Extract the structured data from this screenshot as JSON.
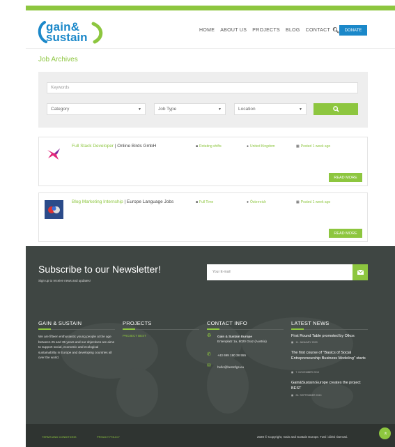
{
  "header": {
    "logo_line1": "gain&",
    "logo_line2": "sustain",
    "nav": [
      "HOME",
      "ABOUT US",
      "PROJECTS",
      "BLOG",
      "CONTACT"
    ],
    "donate_label": "DONATE"
  },
  "page_title": "Job Archives",
  "search": {
    "keywords_placeholder": "Keywords",
    "category": "Category",
    "job_type": "Job Type",
    "location": "Location"
  },
  "jobs": [
    {
      "title": "Full Stack Developer",
      "company": "Online Birds GmbH",
      "type": "Rotating shifts",
      "location": "United Kingdom",
      "posted": "Posted 1 week ago",
      "read_more": "READ MORE"
    },
    {
      "title": "Blog Marketing Internship",
      "company": "Europe Language Jobs",
      "type": "Full Time",
      "location": "Österreich",
      "posted": "Posted 1 week ago",
      "read_more": "READ MORE"
    }
  ],
  "footer": {
    "subscribe_title": "Subscribe to our Newsletter!",
    "subscribe_sub": "Sign up to receive news and updates!",
    "email_placeholder": "Your E-mail",
    "cols": {
      "about_head": "GAIN & SUSTAIN",
      "about_text": "We are fifteen enthusiastic young people at the age between 25 and 35 years and our objectives are aims to support social, economic and ecological sustainability in Europe and developing countries all over the world.",
      "projects_head": "PROJECTS",
      "project_link": "PROJECT BEST",
      "contact_head": "CONTACT INFO",
      "contact_name": "Gain & Sustain Europe",
      "contact_address": "Entenplatz 1a, 8020 Graz (Austria)",
      "contact_phone": "+43 699 190 38 555",
      "contact_email": "hello@bestofgs.eu",
      "news_head": "LATEST NEWS",
      "news": [
        {
          "title": "First Round Table promoted by Oikos",
          "date": "11. JANUARY 2020"
        },
        {
          "title": "The first course of \"Basics of Social Entrepreneurship Business Modeling\" starts",
          "date": "7. NOVEMBER 2019"
        },
        {
          "title": "Gain&Sustain:Europe creates the project BEST",
          "date": "26. SEPTEMBER 2019"
        }
      ]
    },
    "bottom_links": [
      "TERMS AND CONDITIONS",
      "PRIVACY POLICY"
    ],
    "copyright": "2020 © Copyright, Gain and Sustain Europe. Tutti i diritti riservati."
  },
  "colors": {
    "accent_green": "#8dc63f",
    "brand_blue": "#1b88c9",
    "footer_bg": "#3f4643"
  }
}
